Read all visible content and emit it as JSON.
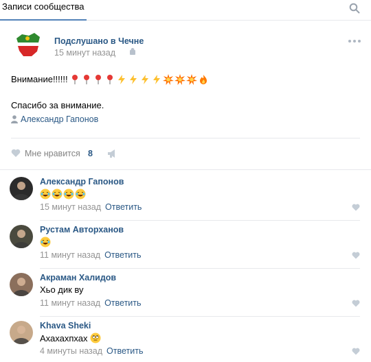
{
  "header": {
    "tab_label": "Записи сообщества"
  },
  "post": {
    "author": "Подслушано в Чечне",
    "time": "15 минут назад",
    "text_prefix": "Внимание!!!!!!",
    "text_emojis": [
      "pin",
      "pin",
      "pin",
      "pin",
      "zap",
      "zap",
      "zap",
      "zap",
      "boom",
      "boom",
      "boom",
      "fire"
    ],
    "text_line2": "Спасибо за внимание.",
    "signer": "Александр Гапонов",
    "like_label": "Мне нравится",
    "like_count": "8"
  },
  "comments": [
    {
      "author": "Александр Гапонов",
      "text": "",
      "emojis": [
        "laugh",
        "laugh",
        "laugh",
        "laugh"
      ],
      "time": "15 минут назад",
      "reply": "Ответить",
      "avatar_color": "#2b2b2b"
    },
    {
      "author": "Рустам Авторханов",
      "text": "",
      "emojis": [
        "laugh"
      ],
      "time": "11 минут назад",
      "reply": "Ответить",
      "avatar_color": "#4a4a3e"
    },
    {
      "author": "Акраман Халидов",
      "text": "Хьо дик ву",
      "emojis": [],
      "time": "11 минут назад",
      "reply": "Ответить",
      "avatar_color": "#8b6f5c"
    },
    {
      "author": "Khava Sheki",
      "text": "Ахахахпхах",
      "emojis": [
        "rolleyes"
      ],
      "time": "4 минуты назад",
      "reply": "Ответить",
      "avatar_color": "#c7a98a"
    }
  ],
  "colors": {
    "link": "#2a5885",
    "accent": "#5181b8",
    "muted": "#939393"
  }
}
